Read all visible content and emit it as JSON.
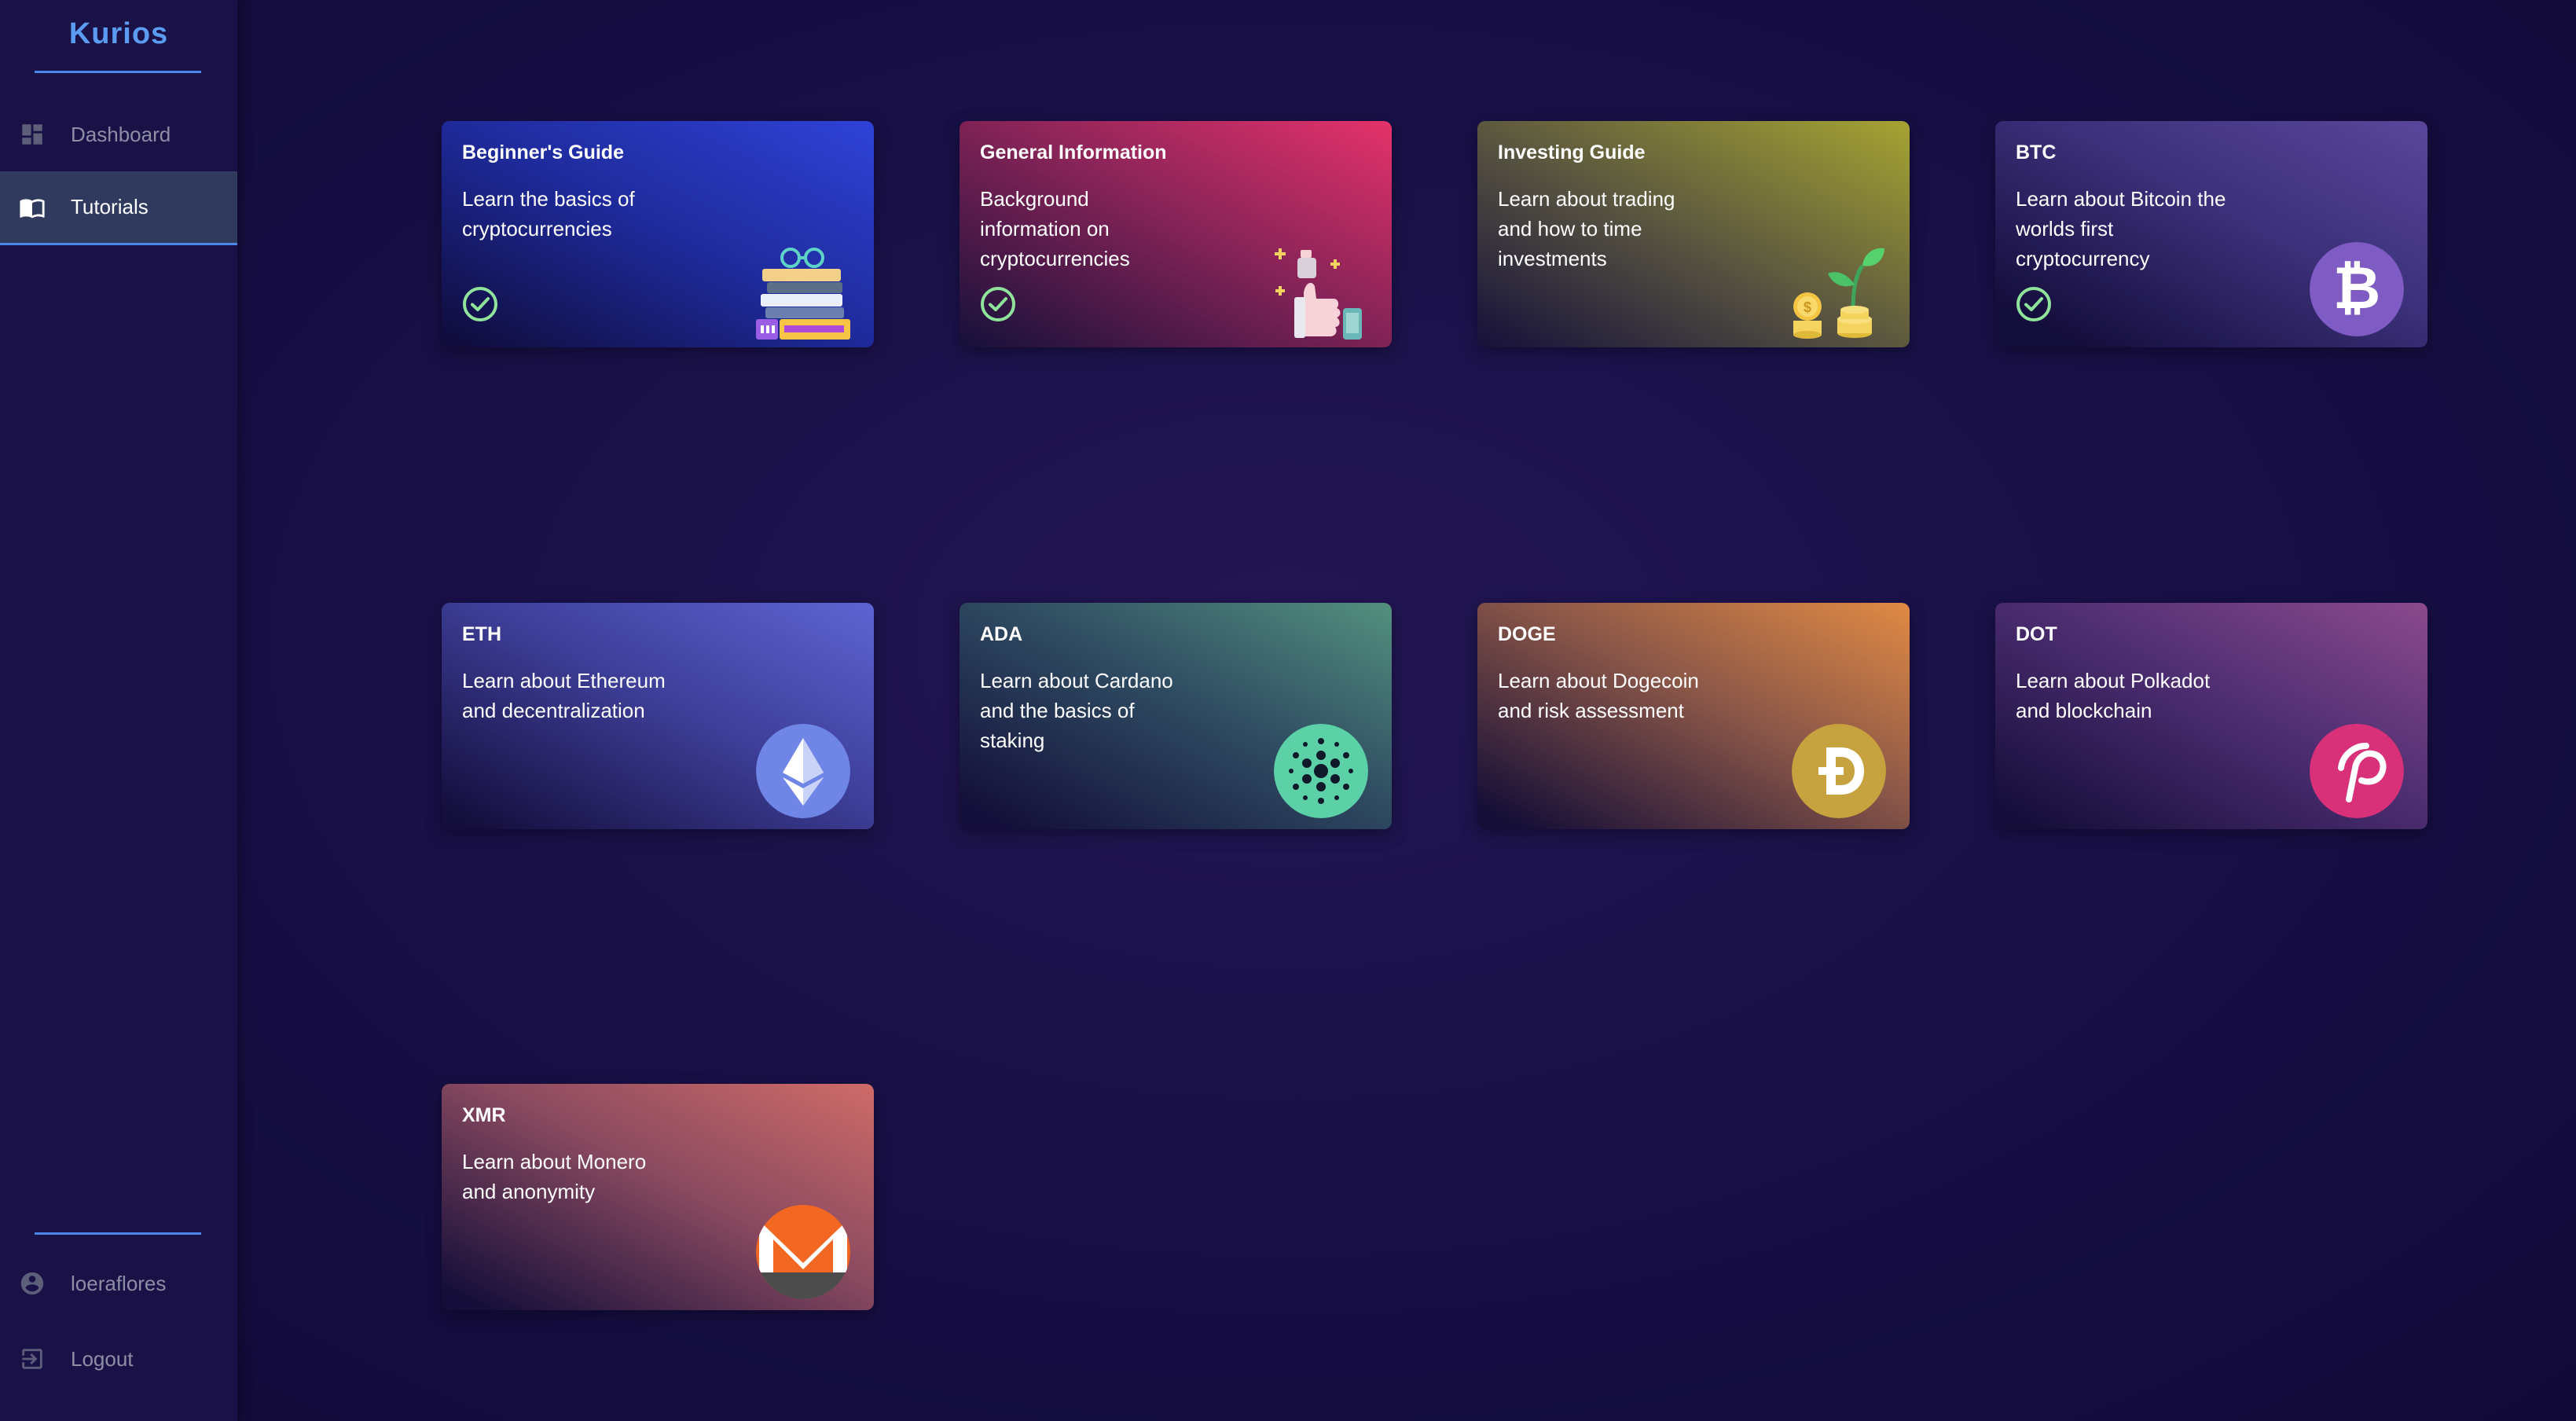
{
  "sidebar": {
    "brand": "Kurios",
    "nav": [
      {
        "label": "Dashboard",
        "icon": "dashboard-icon",
        "active": false
      },
      {
        "label": "Tutorials",
        "icon": "book-icon",
        "active": true
      }
    ],
    "user": {
      "label": "loeraflores",
      "icon": "account-circle-icon"
    },
    "logout": {
      "label": "Logout",
      "icon": "logout-icon"
    }
  },
  "colors": {
    "accent": "#4a86e8",
    "brand": "#5b9cf2",
    "completed_check": "#8fe39a",
    "background": "#150d3f"
  },
  "tutorials": [
    {
      "title": "Beginner's Guide",
      "desc": "Learn the basics of cryptocurrencies",
      "completed": true,
      "icon": "books-icon"
    },
    {
      "title": "General Information",
      "desc": "Background information on cryptocurrencies",
      "completed": true,
      "icon": "thumbs-up-icon"
    },
    {
      "title": "Investing Guide",
      "desc": "Learn about trading and how to time investments",
      "completed": false,
      "icon": "coin-plant-icon"
    },
    {
      "title": "BTC",
      "desc": "Learn about Bitcoin the worlds first cryptocurrency",
      "completed": true,
      "icon": "bitcoin-icon"
    },
    {
      "title": "ETH",
      "desc": "Learn about Ethereum and decentralization",
      "completed": false,
      "icon": "ethereum-icon"
    },
    {
      "title": "ADA",
      "desc": "Learn about Cardano and the basics of staking",
      "completed": false,
      "icon": "cardano-icon"
    },
    {
      "title": "DOGE",
      "desc": "Learn about Dogecoin and risk assessment",
      "completed": false,
      "icon": "dogecoin-icon"
    },
    {
      "title": "DOT",
      "desc": "Learn about Polkadot and blockchain",
      "completed": false,
      "icon": "polkadot-icon"
    },
    {
      "title": "XMR",
      "desc": "Learn about Monero and anonymity",
      "completed": false,
      "icon": "monero-icon"
    }
  ]
}
